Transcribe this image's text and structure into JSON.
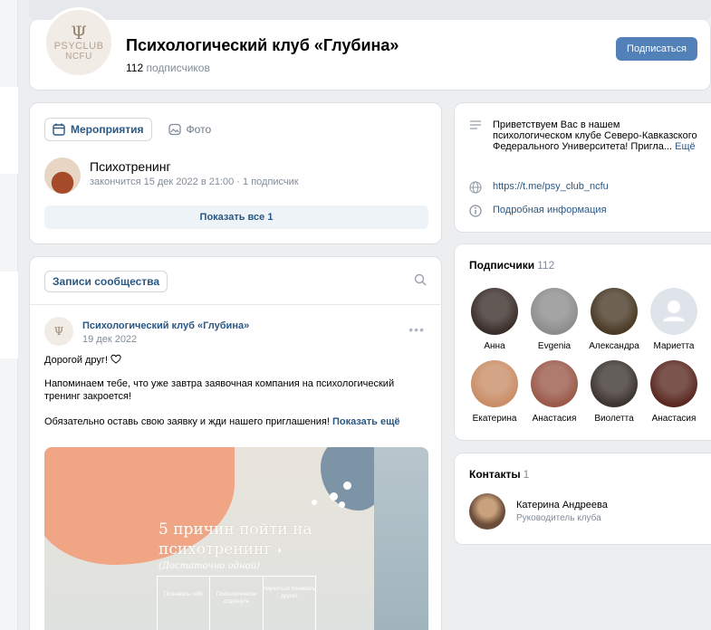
{
  "header": {
    "logo_symbol": "Ψ",
    "logo_line1": "PSYCLUB",
    "logo_line2": "NCFU",
    "title": "Психологический клуб «Глубина»",
    "subscribers_num": "112",
    "subscribers_word": "подписчиков",
    "subscribe_label": "Подписаться"
  },
  "events": {
    "tabs": [
      {
        "label": "Мероприятия",
        "icon": "calendar-icon",
        "active": true
      },
      {
        "label": "Фото",
        "icon": "photo-icon",
        "active": false
      }
    ],
    "item": {
      "title": "Психотренинг",
      "subtitle": "закончится 15 дек 2022 в 21:00 · 1 подписчик"
    },
    "show_all": "Показать все 1"
  },
  "posts": {
    "tab_label": "Записи сообщества",
    "post": {
      "author": "Психологический клуб «Глубина»",
      "date": "19 дек 2022",
      "line1": "Дорогой друг!",
      "line2": "Напоминаем тебе, что уже завтра заявочная компания на психологический тренинг закроется!",
      "line3": "Обязательно оставь свою заявку и жди нашего приглашения!",
      "more": "Показать ещё",
      "image": {
        "title_l1": "5 причин пойти на",
        "title_l2": "психотренинг",
        "subtitle": "(Достаточно одной)",
        "cells": [
          "Познавать себя",
          "Психологически отдохнуть",
          "Научиться понимать других"
        ]
      }
    }
  },
  "about": {
    "description": "Приветствуем Вас в нашем психологическом клубе Северо-Кавказского Федерального Университета! Пригла...",
    "more": "Ещё",
    "link": "https://t.me/psy_club_ncfu",
    "details": "Подробная информация"
  },
  "members": {
    "title": "Подписчики",
    "count": "112",
    "list": [
      {
        "name": "Анна",
        "color": "#3a2e2a"
      },
      {
        "name": "Evgenia",
        "color": "#8d8d8d"
      },
      {
        "name": "Александра",
        "color": "#4a3a26"
      },
      {
        "name": "Мариетта",
        "color": "#dfe4ea"
      },
      {
        "name": "Екатерина",
        "color": "#c98e68"
      },
      {
        "name": "Анастасия",
        "color": "#9a5a4a"
      },
      {
        "name": "Виолетта",
        "color": "#3d3531"
      },
      {
        "name": "Анастасия",
        "color": "#5a2a22"
      }
    ]
  },
  "contacts": {
    "title": "Контакты",
    "count": "1",
    "name": "Катерина Андреева",
    "role": "Руководитель клуба"
  },
  "colors": {
    "accent": "#5181b8",
    "link": "#2a5885",
    "muted": "#818c99"
  }
}
